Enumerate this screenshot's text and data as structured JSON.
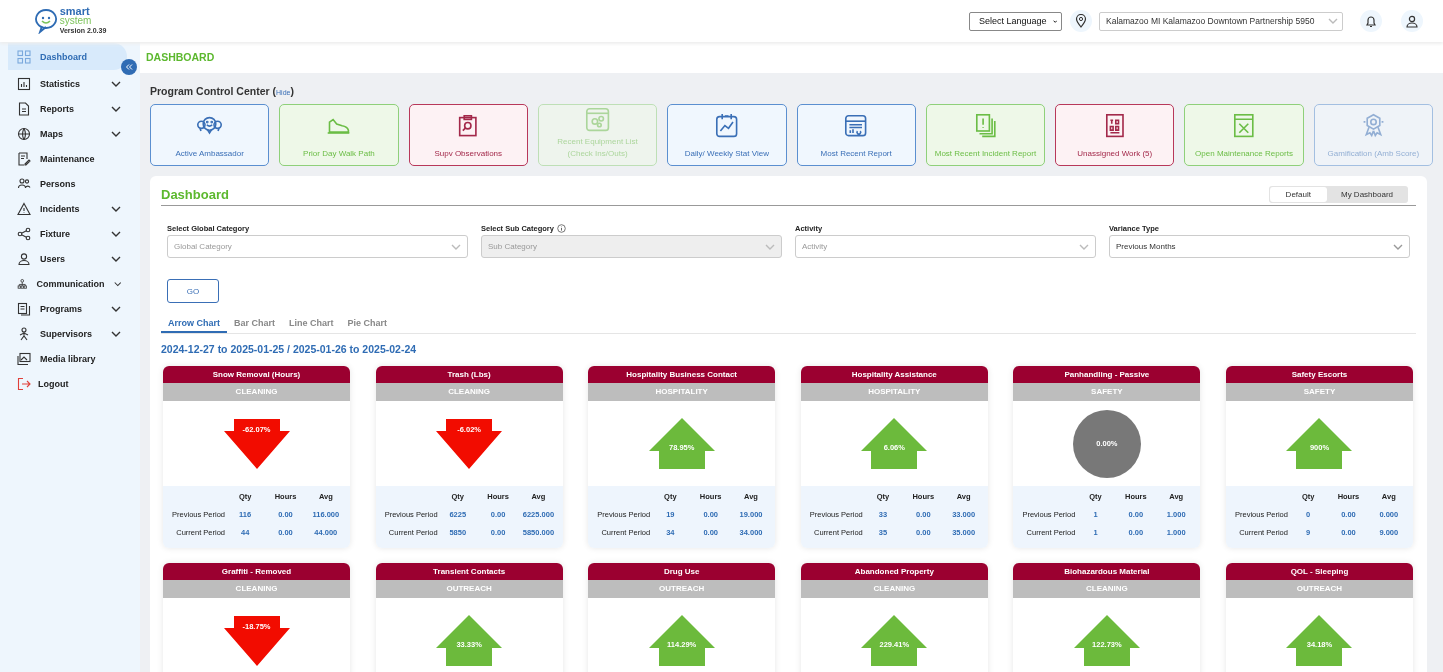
{
  "header": {
    "logo": {
      "word_1": "smart",
      "word_2": "system",
      "version": "Version 2.0.39"
    },
    "language_select": "Select Language",
    "location_select": "Kalamazoo MI Kalamazoo Downtown Partnership 5950"
  },
  "sidebar": {
    "items": [
      {
        "label": "Dashboard",
        "selected": true,
        "expandable": false
      },
      {
        "label": "Statistics",
        "selected": false,
        "expandable": true
      },
      {
        "label": "Reports",
        "selected": false,
        "expandable": true
      },
      {
        "label": "Maps",
        "selected": false,
        "expandable": true
      },
      {
        "label": "Maintenance",
        "selected": false,
        "expandable": false
      },
      {
        "label": "Persons",
        "selected": false,
        "expandable": false
      },
      {
        "label": "Incidents",
        "selected": false,
        "expandable": true
      },
      {
        "label": "Fixture",
        "selected": false,
        "expandable": true
      },
      {
        "label": "Users",
        "selected": false,
        "expandable": true
      },
      {
        "label": "Communication",
        "selected": false,
        "expandable": true
      },
      {
        "label": "Programs",
        "selected": false,
        "expandable": true
      },
      {
        "label": "Supervisors",
        "selected": false,
        "expandable": true
      },
      {
        "label": "Media library",
        "selected": false,
        "expandable": false
      },
      {
        "label": "Logout",
        "selected": false,
        "expandable": false,
        "kind": "logout"
      }
    ]
  },
  "page_title": "DASHBOARD",
  "control_center": {
    "title": "Program Control Center (",
    "hide_link": "Hide",
    "title_end": ")",
    "tiles": [
      {
        "label": "Active Ambassador",
        "kind": "primary",
        "disabled": false
      },
      {
        "label": "Prior Day Walk Path",
        "kind": "success",
        "disabled": false
      },
      {
        "label": "Supv Observations",
        "kind": "danger",
        "disabled": false
      },
      {
        "label": "Recent Equipment List (Check Ins/Outs)",
        "kind": "success",
        "disabled": true
      },
      {
        "label": "Daily/ Weekly Stat View",
        "kind": "primary",
        "disabled": false
      },
      {
        "label": "Most Recent Report",
        "kind": "primary",
        "disabled": false
      },
      {
        "label": "Most Recent Incident Report",
        "kind": "success",
        "disabled": false
      },
      {
        "label": "Unassigned Work (5)",
        "kind": "danger",
        "disabled": false
      },
      {
        "label": "Open Maintenance Reports",
        "kind": "success",
        "disabled": false
      },
      {
        "label": "Gamification (Amb Score)",
        "kind": "primary",
        "disabled": true
      }
    ]
  },
  "dashboard": {
    "title": "Dashboard",
    "view_toggle": [
      {
        "label": "Default",
        "selected": true
      },
      {
        "label": "My Dashboard",
        "selected": false
      }
    ],
    "filters": [
      {
        "label": "Select Global Category",
        "placeholder": "Global Category",
        "disabled": false,
        "info": false
      },
      {
        "label": "Select Sub Category",
        "placeholder": "Sub Category",
        "disabled": true,
        "info": true
      },
      {
        "label": "Activity",
        "placeholder": "Activity",
        "disabled": false,
        "info": false
      },
      {
        "label": "Variance Type",
        "value": "Previous Months",
        "disabled": false,
        "info": false
      }
    ],
    "go_button": "GO",
    "tabs": [
      {
        "label": "Arrow Chart",
        "selected": true
      },
      {
        "label": "Bar Chart",
        "selected": false
      },
      {
        "label": "Line Chart",
        "selected": false
      },
      {
        "label": "Pie Chart",
        "selected": false
      }
    ],
    "date_range": "2024-12-27 to 2025-01-25 / 2025-01-26 to 2025-02-24",
    "cards": [
      {
        "title": "Snow Removal (Hours)",
        "category": "CLEANING",
        "change": "-62.07%",
        "kind": "down",
        "columns": [
          "Qty",
          "Hours",
          "Avg"
        ],
        "rows": [
          {
            "label": "Previous Period",
            "values": [
              "116",
              "0.00",
              "116.000"
            ]
          },
          {
            "label": "Current Period",
            "values": [
              "44",
              "0.00",
              "44.000"
            ]
          }
        ]
      },
      {
        "title": "Trash (Lbs)",
        "category": "CLEANING",
        "change": "-6.02%",
        "kind": "down",
        "columns": [
          "Qty",
          "Hours",
          "Avg"
        ],
        "rows": [
          {
            "label": "Previous Period",
            "values": [
              "6225",
              "0.00",
              "6225.000"
            ]
          },
          {
            "label": "Current Period",
            "values": [
              "5850",
              "0.00",
              "5850.000"
            ]
          }
        ]
      },
      {
        "title": "Hospitality Business Contact",
        "category": "HOSPITALITY",
        "change": "78.95%",
        "kind": "up",
        "columns": [
          "Qty",
          "Hours",
          "Avg"
        ],
        "rows": [
          {
            "label": "Previous Period",
            "values": [
              "19",
              "0.00",
              "19.000"
            ]
          },
          {
            "label": "Current Period",
            "values": [
              "34",
              "0.00",
              "34.000"
            ]
          }
        ]
      },
      {
        "title": "Hospitality Assistance",
        "category": "HOSPITALITY",
        "change": "6.06%",
        "kind": "up",
        "columns": [
          "Qty",
          "Hours",
          "Avg"
        ],
        "rows": [
          {
            "label": "Previous Period",
            "values": [
              "33",
              "0.00",
              "33.000"
            ]
          },
          {
            "label": "Current Period",
            "values": [
              "35",
              "0.00",
              "35.000"
            ]
          }
        ]
      },
      {
        "title": "Panhandling - Passive",
        "category": "SAFETY",
        "change": "0.00%",
        "kind": "flat",
        "columns": [
          "Qty",
          "Hours",
          "Avg"
        ],
        "rows": [
          {
            "label": "Previous Period",
            "values": [
              "1",
              "0.00",
              "1.000"
            ]
          },
          {
            "label": "Current Period",
            "values": [
              "1",
              "0.00",
              "1.000"
            ]
          }
        ]
      },
      {
        "title": "Safety Escorts",
        "category": "SAFETY",
        "change": "900%",
        "kind": "up",
        "columns": [
          "Qty",
          "Hours",
          "Avg"
        ],
        "rows": [
          {
            "label": "Previous Period",
            "values": [
              "0",
              "0.00",
              "0.000"
            ]
          },
          {
            "label": "Current Period",
            "values": [
              "9",
              "0.00",
              "9.000"
            ]
          }
        ]
      },
      {
        "title": "Graffiti - Removed",
        "category": "CLEANING",
        "change": "-18.75%",
        "kind": "down"
      },
      {
        "title": "Transient Contacts",
        "category": "OUTREACH",
        "change": "33.33%",
        "kind": "up"
      },
      {
        "title": "Drug Use",
        "category": "OUTREACH",
        "change": "114.29%",
        "kind": "up"
      },
      {
        "title": "Abandoned Property",
        "category": "CLEANING",
        "change": "229.41%",
        "kind": "up"
      },
      {
        "title": "Biohazardous Material",
        "category": "CLEANING",
        "change": "122.73%",
        "kind": "up"
      },
      {
        "title": "QOL - Sleeping",
        "category": "OUTREACH",
        "change": "34.18%",
        "kind": "up"
      }
    ]
  }
}
